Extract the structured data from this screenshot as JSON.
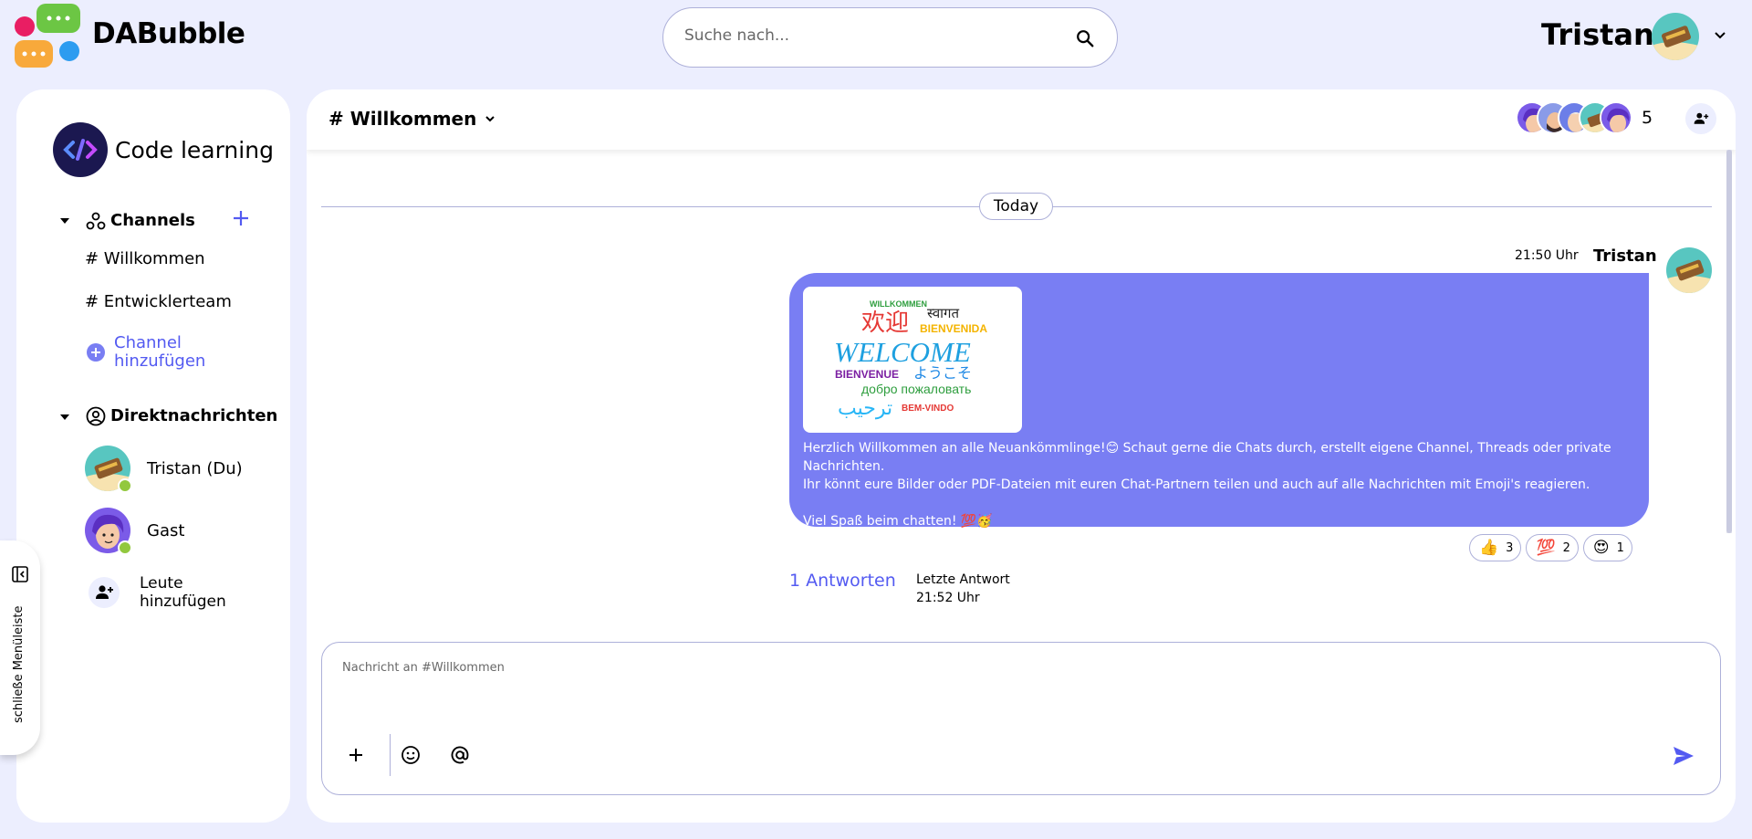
{
  "app": {
    "brand": "DABubble",
    "search_placeholder": "Suche nach...",
    "user_name": "Tristan"
  },
  "sidebar": {
    "workspace_name": "Code learning",
    "channels_title": "Channels",
    "channels": [
      {
        "label": "# Willkommen"
      },
      {
        "label": "# Entwicklerteam"
      }
    ],
    "add_channel_label_1": "Channel",
    "add_channel_label_2": "hinzufügen",
    "dm_title": "Direktnachrichten",
    "dms": [
      {
        "name": "Tristan (Du)",
        "online": true
      },
      {
        "name": "Gast",
        "online": true
      }
    ],
    "add_people_label_1": "Leute",
    "add_people_label_2": "hinzufügen",
    "toggle_label": "schließe Menüleiste"
  },
  "chat": {
    "channel_title": "# Willkommen",
    "member_count": "5",
    "day_label": "Today",
    "message": {
      "time": "21:50 Uhr",
      "author": "Tristan",
      "image_words": {
        "w1": "WILLKOMMEN",
        "w2": "स्वागत",
        "w3": "欢迎",
        "w4": "BIENVENIDA",
        "w5": "WELCOME",
        "w6": "BIENVENUE",
        "w7": "ようこそ",
        "w8": "добро пожаловать",
        "w9": "ترحيب",
        "w10": "BEM-VINDO"
      },
      "line1": "Herzlich Willkommen an alle Neuankömmlinge!😊 Schaut gerne die Chats durch, erstellt eigene Channel, Threads oder private Nachrichten.",
      "line2": "Ihr könnt eure Bilder oder PDF-Dateien mit euren Chat-Partnern teilen und auch auf alle Nachrichten mit Emoji's reagieren.",
      "line3": "Viel Spaß beim chatten! 💯🥳"
    },
    "reactions": [
      {
        "emoji": "👍",
        "count": "3"
      },
      {
        "emoji": "💯",
        "count": "2"
      },
      {
        "emoji": "😍",
        "count": "1"
      }
    ],
    "replies_label": "1 Antworten",
    "last_reply_label": "Letzte Antwort",
    "last_reply_time": "21:52 Uhr",
    "composer_placeholder": "Nachricht an #Willkommen"
  },
  "colors": {
    "background": "#ECEEFE",
    "accent": "#797EF3",
    "link": "#535AF1",
    "online": "#92C83E"
  }
}
